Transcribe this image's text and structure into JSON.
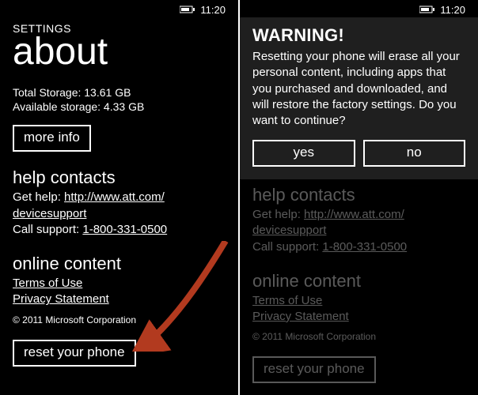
{
  "status": {
    "time": "11:20"
  },
  "left": {
    "settings_label": "SETTINGS",
    "title": "about",
    "storage_total": "Total Storage: 13.61 GB",
    "storage_available": "Available storage: 4.33 GB",
    "more_info": "more info",
    "help_heading": "help contacts",
    "help_prefix": "Get help: ",
    "help_link": "http://www.att.com/",
    "help_link2": "devicesupport",
    "call_prefix": "Call support: ",
    "call_number": "1-800-331-0500",
    "online_heading": "online content",
    "terms": "Terms of Use",
    "privacy": "Privacy Statement",
    "copyright": "© 2011 Microsoft Corporation",
    "reset": "reset your phone"
  },
  "right": {
    "warning_title": "WARNING!",
    "warning_body": "Resetting your phone will erase all your personal content, including apps that you purchased and downloaded, and will restore the factory settings. Do you want to continue?",
    "yes": "yes",
    "no": "no"
  }
}
